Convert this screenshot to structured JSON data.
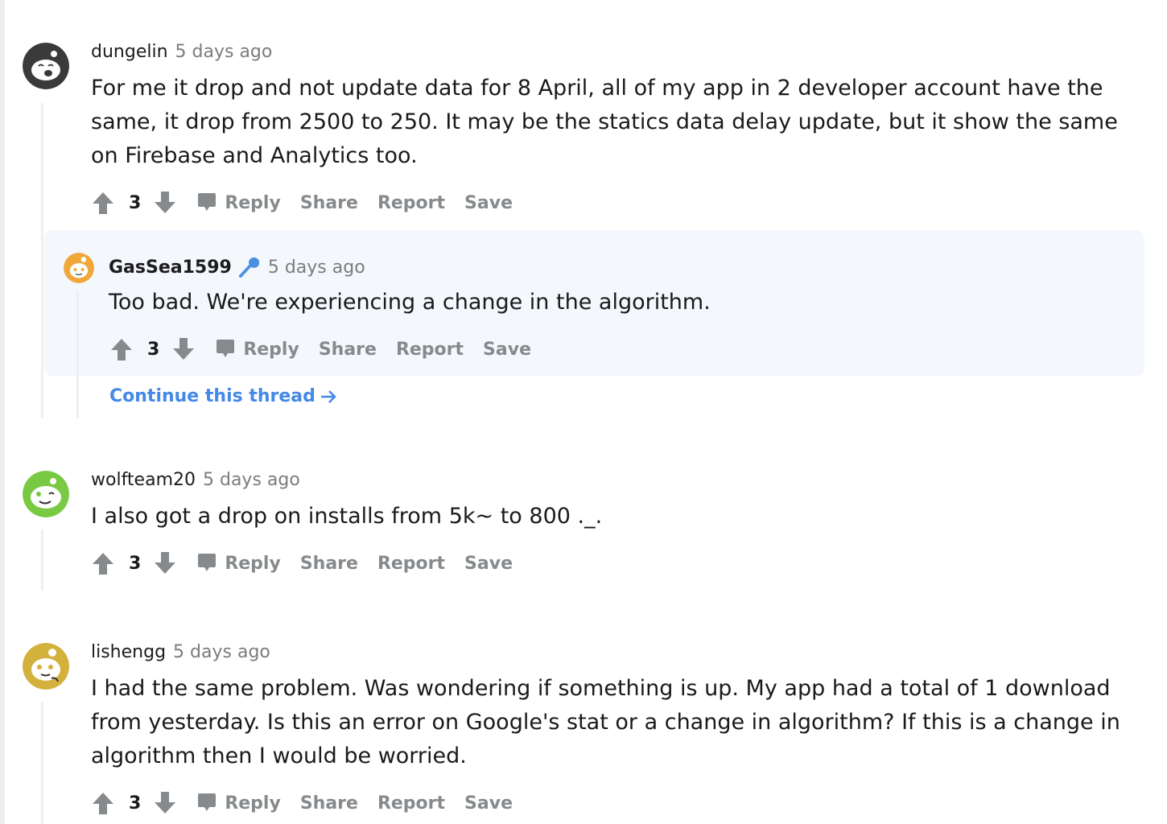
{
  "comments": [
    {
      "author": "dungelin",
      "time": "5 days ago",
      "body": "For me it drop and not update data for 8 April, all of my app in 2 developer account have the same, it drop from 2500 to 250. It may be the statics data delay update, but it show the same on Firebase and Analytics too.",
      "avatar_color": "#3a3a3a",
      "avatar_icon": "snoo-laughing-avatar",
      "score": "3"
    },
    {
      "author": "GasSea1599",
      "author_badge_icon": "microphone-icon",
      "badge_color": "#4a90e2",
      "time": "5 days ago",
      "body": "Too bad. We're experiencing a change in the algorithm.",
      "avatar_color": "#f0a83a",
      "avatar_icon": "snoo-avatar",
      "score": "3",
      "nested": true
    },
    {
      "author": "wolfteam20",
      "time": "5 days ago",
      "body": "I also got a drop on installs from 5k~ to 800 ._.",
      "avatar_color": "#7ac943",
      "avatar_icon": "snoo-winking-avatar",
      "score": "3"
    },
    {
      "author": "lishengg",
      "time": "5 days ago",
      "body": "I had the same problem. Was wondering if something is up. My app had a total of 1 download from yesterday. Is this an error on Google's stat or a change in algorithm? If this is a change in algorithm then I would be worried.",
      "avatar_color": "#d4b03c",
      "avatar_icon": "snoo-thinking-avatar",
      "score": "3"
    }
  ],
  "actions": {
    "reply": "Reply",
    "share": "Share",
    "report": "Report",
    "save": "Save"
  },
  "continue_thread": "Continue this thread",
  "colors": {
    "link": "#4488e8",
    "action_gray": "#878a8c",
    "nested_bg": "#f4f7fc",
    "thread_line": "#edeff1"
  }
}
